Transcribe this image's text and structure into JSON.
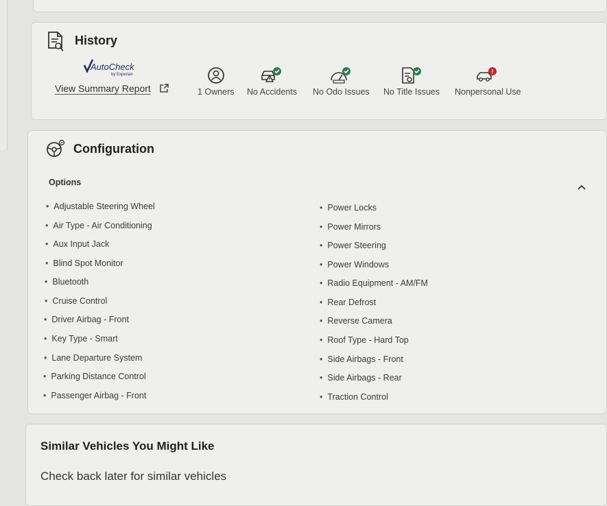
{
  "history": {
    "title": "History",
    "autocheck_logo_text": "AutoCheck",
    "autocheck_logo_sub": "by Experian",
    "summary_link": "View Summary Report",
    "items": [
      {
        "label": "1 Owners",
        "icon": "owner-icon",
        "status": "neutral"
      },
      {
        "label": "No Accidents",
        "icon": "accident-check-icon",
        "status": "ok"
      },
      {
        "label": "No Odo Issues",
        "icon": "odometer-check-icon",
        "status": "ok"
      },
      {
        "label": "No Title Issues",
        "icon": "title-check-icon",
        "status": "ok"
      },
      {
        "label": "Nonpersonal Use",
        "icon": "nonpersonal-use-alert-icon",
        "status": "alert"
      }
    ]
  },
  "configuration": {
    "title": "Configuration",
    "options_label": "Options",
    "left_options": [
      "Adjustable Steering Wheel",
      "Air Type - Air Conditioning",
      "Aux Input Jack",
      "Blind Spot Monitor",
      "Bluetooth",
      "Cruise Control",
      "Driver Airbag - Front",
      "Key Type - Smart",
      "Lane Departure System",
      "Parking Distance Control",
      "Passenger Airbag - Front"
    ],
    "right_options": [
      "Power Locks",
      "Power Mirrors",
      "Power Steering",
      "Power Windows",
      "Radio Equipment - AM/FM",
      "Rear Defrost",
      "Reverse Camera",
      "Roof Type - Hard Top",
      "Side Airbags - Front",
      "Side Airbags - Rear",
      "Traction Control"
    ]
  },
  "similar": {
    "title": "Similar Vehicles You Might Like",
    "message": "Check back later for similar vehicles"
  },
  "colors": {
    "ok_badge": "#2e7d4f",
    "alert_badge": "#c0262d",
    "icon_stroke": "#333333"
  }
}
